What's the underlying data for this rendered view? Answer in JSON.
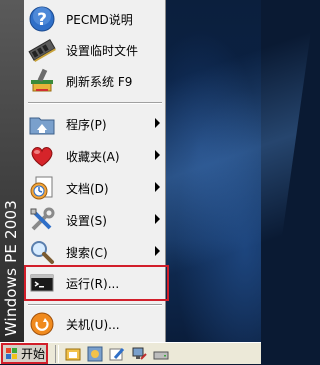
{
  "menu": {
    "side_banner": "Windows PE 2003",
    "items": [
      {
        "label": "PECMD说明",
        "icon": "help-icon"
      },
      {
        "label": "设置临时文件",
        "icon": "memory-chip-icon"
      },
      {
        "label": "刷新系统 F9",
        "icon": "refresh-paintbrush-icon"
      },
      {
        "label": "程序(P)",
        "icon": "programs-folder-icon",
        "submenu": true
      },
      {
        "label": "收藏夹(A)",
        "icon": "favorites-heart-icon",
        "submenu": true
      },
      {
        "label": "文档(D)",
        "icon": "documents-icon",
        "submenu": true
      },
      {
        "label": "设置(S)",
        "icon": "settings-tools-icon",
        "submenu": true
      },
      {
        "label": "搜索(C)",
        "icon": "search-magnifier-icon",
        "submenu": true
      },
      {
        "label": "运行(R)...",
        "icon": "run-console-icon"
      },
      {
        "label": "关机(U)...",
        "icon": "shutdown-icon"
      }
    ]
  },
  "taskbar": {
    "start_label": "开始",
    "quick_launch": [
      "folder-icon",
      "explorer-icon",
      "pen-icon",
      "network-icon",
      "drive-icon"
    ]
  },
  "colors": {
    "highlight": "#d21e2a",
    "menu_bg": "#f0f0f0",
    "side_banner_bg": "#3a3a3a",
    "taskbar_bg": "#ece9d8"
  }
}
